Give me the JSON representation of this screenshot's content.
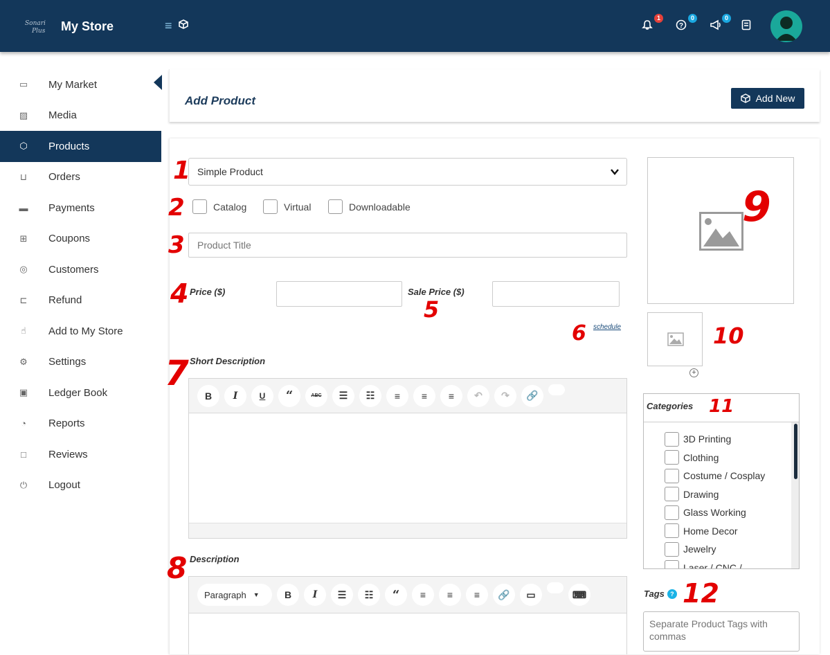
{
  "app": {
    "brand": "My Store",
    "logo_text": "Sonari Plus"
  },
  "topbar": {
    "icons": [
      {
        "name": "notification-bell-icon",
        "badge": "1",
        "badge_color": "#e5413a"
      },
      {
        "name": "help-circle-icon",
        "badge": "0",
        "badge_color": "#1aa7e0"
      },
      {
        "name": "megaphone-icon",
        "badge": "0",
        "badge_color": "#1aa7e0"
      },
      {
        "name": "clipboard-icon"
      }
    ]
  },
  "sidebar": {
    "items": [
      {
        "label": "My Market",
        "icon": "laptop-icon"
      },
      {
        "label": "Media",
        "icon": "image-icon"
      },
      {
        "label": "Products",
        "icon": "cube-icon",
        "active": true
      },
      {
        "label": "Orders",
        "icon": "cart-icon"
      },
      {
        "label": "Payments",
        "icon": "credit-card-icon"
      },
      {
        "label": "Coupons",
        "icon": "gift-icon"
      },
      {
        "label": "Customers",
        "icon": "user-circle-icon"
      },
      {
        "label": "Refund",
        "icon": "refund-icon"
      },
      {
        "label": "Add to My Store",
        "icon": "hand-pointer-icon"
      },
      {
        "label": "Settings",
        "icon": "cogs-icon"
      },
      {
        "label": "Ledger Book",
        "icon": "money-icon"
      },
      {
        "label": "Reports",
        "icon": "pie-chart-icon"
      },
      {
        "label": "Reviews",
        "icon": "comment-icon"
      },
      {
        "label": "Logout",
        "icon": "power-icon"
      }
    ]
  },
  "header": {
    "title": "Add Product",
    "add_new_label": "Add New"
  },
  "form": {
    "product_type": "Simple Product",
    "checkboxes": [
      "Catalog",
      "Virtual",
      "Downloadable"
    ],
    "title_placeholder": "Product Title",
    "price_label": "Price ($)",
    "sale_price_label": "Sale Price ($)",
    "schedule_label": "schedule",
    "short_description_label": "Short Description",
    "description_label": "Description",
    "paragraph_label": "Paragraph"
  },
  "categories": {
    "title": "Categories",
    "items": [
      "3D Printing",
      "Clothing",
      "Costume / Cosplay",
      "Drawing",
      "Glass Working",
      "Home Decor",
      "Jewelry",
      "Laser / CNC /"
    ]
  },
  "tags": {
    "label": "Tags",
    "placeholder": "Separate Product Tags with commas"
  },
  "annotations": [
    "1",
    "2",
    "3",
    "4",
    "5",
    "6",
    "7",
    "8",
    "9",
    "10",
    "11",
    "12"
  ],
  "colors": {
    "navy": "#13375a",
    "annotation_red": "#e30000"
  }
}
